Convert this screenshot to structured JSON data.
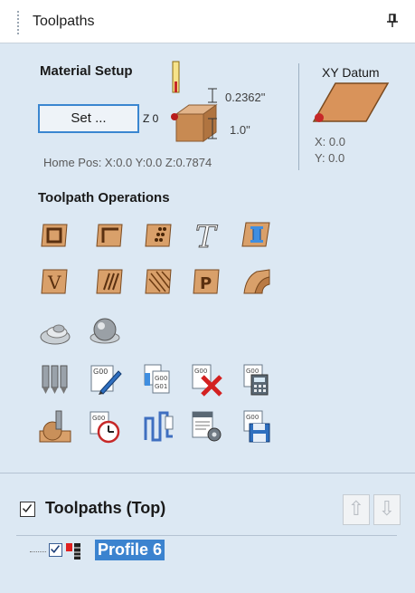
{
  "panel": {
    "title": "Toolpaths"
  },
  "material_setup": {
    "heading": "Material Setup",
    "set_button": "Set ...",
    "z0_label": "Z 0",
    "top_offset": "0.2362\"",
    "thickness": "1.0\"",
    "home_pos": "Home Pos:  X:0.0 Y:0.0 Z:0.7874"
  },
  "xy_datum": {
    "title": "XY Datum",
    "x": "X: 0.0",
    "y": "Y: 0.0"
  },
  "operations": {
    "heading": "Toolpath Operations"
  },
  "tree": {
    "heading": "Toolpaths (Top)",
    "items": [
      {
        "label": "Profile 6",
        "checked": true
      }
    ]
  },
  "colors": {
    "panel_bg": "#dce8f3",
    "selection": "#3b83cf",
    "set_border": "#3a86d0"
  }
}
